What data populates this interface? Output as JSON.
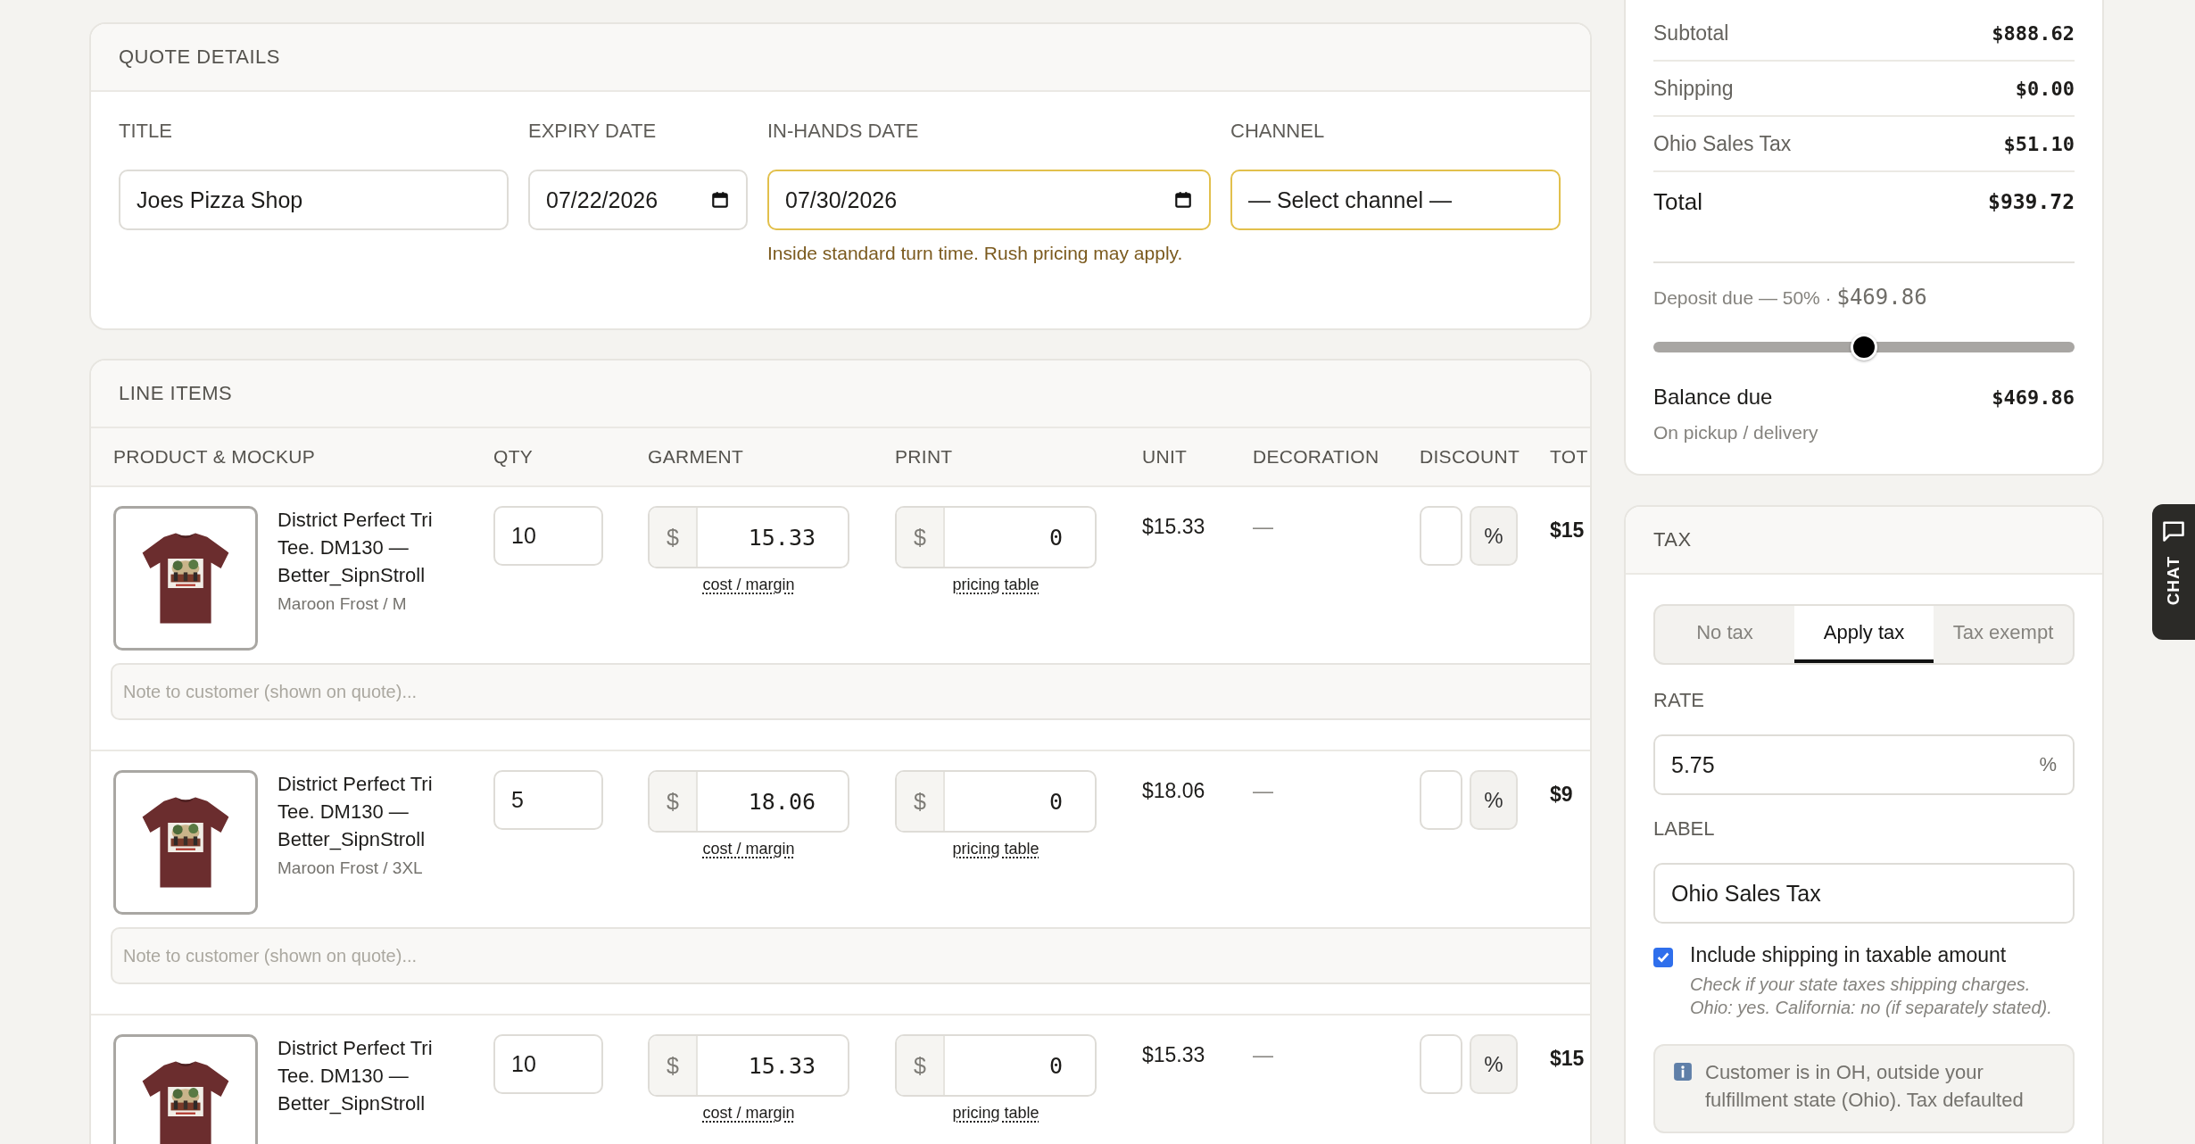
{
  "quote_details": {
    "title": "QUOTE DETAILS",
    "fields": [
      {
        "label": "TITLE",
        "kind": "text",
        "value": "Joes Pizza Shop",
        "highlighted": false
      },
      {
        "label": "EXPIRY DATE",
        "kind": "date",
        "value": "07/22/2026",
        "highlighted": false
      },
      {
        "label": "IN-HANDS DATE",
        "kind": "date",
        "value": "07/30/2026",
        "highlighted": true,
        "hint": "Inside standard turn time. Rush pricing may apply."
      },
      {
        "label": "CHANNEL",
        "kind": "select",
        "value": "— Select channel —",
        "highlighted": true
      }
    ]
  },
  "line_items": {
    "title": "LINE ITEMS",
    "columns": [
      "PRODUCT & MOCKUP",
      "QTY",
      "GARMENT",
      "PRINT",
      "UNIT",
      "DECORATION",
      "DISCOUNT",
      "TOT"
    ],
    "rows": [
      {
        "product": "District Perfect Tri Tee. DM130 — Better_SipnStroll",
        "variant": "Maroon Frost / M",
        "qty": "10",
        "currency": "$",
        "garment": "15.33",
        "garment_link": "cost / margin",
        "print": "0",
        "print_link": "pricing table",
        "unit": "$15.33",
        "decoration": "—",
        "discount_unit": "%",
        "total": "$15",
        "note_placeholder": "Note to customer (shown on quote)..."
      },
      {
        "product": "District Perfect Tri Tee. DM130 — Better_SipnStroll",
        "variant": "Maroon Frost / 3XL",
        "qty": "5",
        "currency": "$",
        "garment": "18.06",
        "garment_link": "cost / margin",
        "print": "0",
        "print_link": "pricing table",
        "unit": "$18.06",
        "decoration": "—",
        "discount_unit": "%",
        "total": "$9",
        "note_placeholder": "Note to customer (shown on quote)..."
      },
      {
        "product": "District Perfect Tri Tee. DM130 — Better_SipnStroll",
        "qty": "10",
        "currency": "$",
        "garment": "15.33",
        "garment_link": "cost / margin",
        "print": "0",
        "print_link": "pricing table",
        "unit": "$15.33",
        "decoration": "—",
        "discount_unit": "%",
        "total": "$15"
      }
    ]
  },
  "summary": {
    "rows": [
      {
        "label": "Subtotal",
        "value": "$888.62",
        "kind": "line"
      },
      {
        "label": "Shipping",
        "value": "$0.00",
        "kind": "line"
      },
      {
        "label": "Ohio Sales Tax",
        "value": "$51.10",
        "kind": "line"
      },
      {
        "label": "Total",
        "value": "$939.72",
        "kind": "total"
      }
    ],
    "deposit": {
      "label": "Deposit due — 50% ·",
      "amount": "$469.86",
      "level": 0.5
    },
    "balance": {
      "label": "Balance due",
      "value": "$469.86",
      "note": "On pickup / delivery"
    }
  },
  "tax": {
    "title": "TAX",
    "modes": [
      {
        "label": "No tax",
        "selected": false
      },
      {
        "label": "Apply tax",
        "selected": true
      },
      {
        "label": "Tax exempt",
        "selected": false
      }
    ],
    "rate": {
      "label": "RATE",
      "value": "5.75",
      "unit": "%"
    },
    "label_field": {
      "label": "LABEL",
      "value": "Ohio Sales Tax"
    },
    "include_shipping": {
      "label": "Include shipping in taxable amount",
      "checked": true,
      "help_lines": [
        "Check if your state taxes shipping charges.",
        "Ohio: yes. California: no (if separately stated)."
      ]
    },
    "info_lines": [
      "Customer is in OH, outside your",
      "fulfillment state (Ohio). Tax defaulted"
    ]
  },
  "chat_tab": {
    "label": "CHAT"
  }
}
